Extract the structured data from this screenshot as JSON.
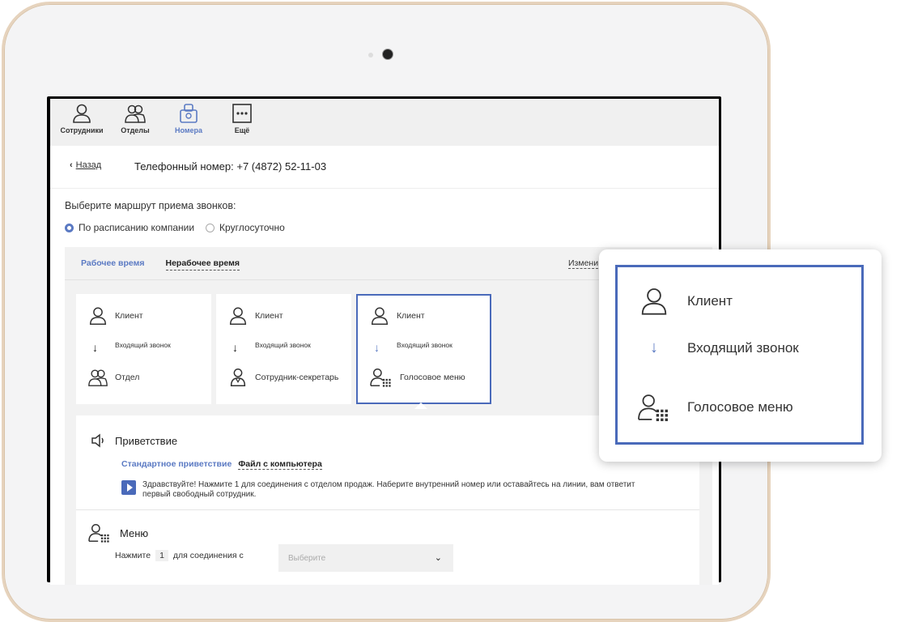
{
  "nav": [
    {
      "label": "Сотрудники",
      "icon": "person-icon",
      "active": false
    },
    {
      "label": "Отделы",
      "icon": "group-icon",
      "active": false
    },
    {
      "label": "Номера",
      "icon": "numbers-icon",
      "active": true
    },
    {
      "label": "Ещё",
      "icon": "more-icon",
      "active": false
    }
  ],
  "header": {
    "back_label": "Назад",
    "title": "Телефонный номер: +7 (4872) 52-11-03"
  },
  "route": {
    "label": "Выберите маршрут приема звонков:",
    "options": [
      {
        "label": "По расписанию компании",
        "selected": true
      },
      {
        "label": "Круглосуточно",
        "selected": false
      }
    ]
  },
  "schedule": {
    "tabs": [
      "Рабочее время",
      "Нерабочее время"
    ],
    "change_label": "Измени"
  },
  "cards": [
    {
      "client": "Клиент",
      "incoming": "Входящий звонок",
      "target": "Отдел",
      "target_icon": "group-icon",
      "selected": false
    },
    {
      "client": "Клиент",
      "incoming": "Входящий звонок",
      "target": "Сотрудник-секретарь",
      "target_icon": "secretary-icon",
      "selected": false
    },
    {
      "client": "Клиент",
      "incoming": "Входящий звонок",
      "target": "Голосовое меню",
      "target_icon": "voice-menu-icon",
      "selected": true
    }
  ],
  "greeting": {
    "title": "Приветствие",
    "tabs": [
      "Стандартное приветствие",
      "Файл с компьютера"
    ],
    "text": "Здравствуйте! Нажмите 1 для соединения с отделом продаж. Наберите внутренний номер или оставайтесь на линии, вам ответит первый свободный сотрудник."
  },
  "menu": {
    "title": "Меню",
    "press_label": "Нажмите",
    "key": "1",
    "connect_label": "для соединения с",
    "select_placeholder": "Выберите"
  },
  "popup": {
    "client": "Клиент",
    "incoming": "Входящий звонок",
    "voice_menu": "Голосовое меню"
  },
  "colors": {
    "accent": "#5b7ac3",
    "frame_border": "#4a6aba",
    "device_rim": "#e6d3bd"
  }
}
